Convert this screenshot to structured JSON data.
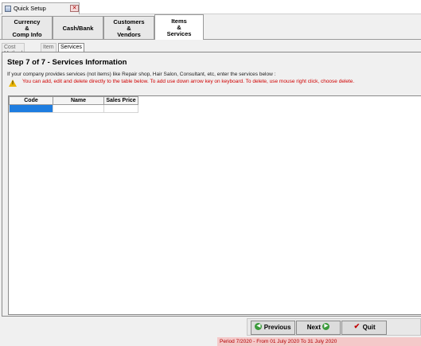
{
  "window": {
    "title": "Quick Setup",
    "close_glyph": "✕"
  },
  "main_tabs": [
    {
      "lines": [
        "Currency",
        "&",
        "Comp Info"
      ]
    },
    {
      "lines": [
        "Cash/Bank"
      ]
    },
    {
      "lines": [
        "Customers",
        "&",
        "Vendors"
      ]
    },
    {
      "lines": [
        "Items",
        "&",
        "Services"
      ],
      "active": true
    }
  ],
  "sub_tabs": [
    "Cost Method",
    "Item",
    "Services"
  ],
  "step": {
    "title": "Step 7 of 7   - Services Information"
  },
  "info_text": "If your company provides services (not items) like Repair shop, Hair Salon, Consultant, etc, enter the services below :",
  "warning_text": "You can add, edit and delete directly to the table below. To add use down arrow key on keyboard. To delete, use mouse right click, choose delete.",
  "table": {
    "columns": [
      "Code",
      "Name",
      "Sales Price"
    ],
    "rows": [
      [
        "",
        "",
        ""
      ]
    ]
  },
  "buttons": {
    "previous": {
      "label": "Previous",
      "icon": "left-arrow-icon"
    },
    "next": {
      "label": "Next",
      "icon": "right-arrow-icon"
    },
    "quit": {
      "label": "Quit",
      "icon": "checkmark-icon"
    }
  },
  "status": "Period 7/2020 - From 01 July 2020 To 31 July 2020",
  "colors": {
    "selection": "#1e7de0",
    "warning": "#d00000",
    "status_bg": "#f4c9c9"
  }
}
